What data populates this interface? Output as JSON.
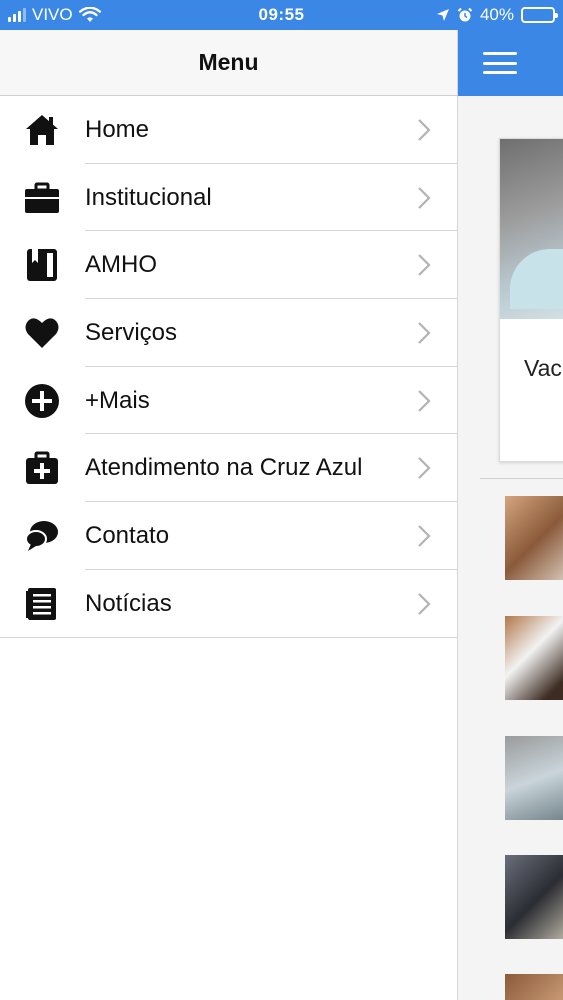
{
  "status_bar": {
    "carrier": "VIVO",
    "time": "09:55",
    "battery": "40%",
    "battery_level": 0.4
  },
  "menu": {
    "title": "Menu",
    "items": [
      {
        "label": "Home",
        "icon": "home-icon"
      },
      {
        "label": "Institucional",
        "icon": "briefcase-icon"
      },
      {
        "label": "AMHO",
        "icon": "book-icon"
      },
      {
        "label": "Serviços",
        "icon": "heart-icon"
      },
      {
        "label": "+Mais",
        "icon": "plus-circle-icon"
      },
      {
        "label": "Atendimento na Cruz Azul",
        "icon": "medkit-icon"
      },
      {
        "label": "Contato",
        "icon": "chat-bubbles-icon"
      },
      {
        "label": "Notícias",
        "icon": "newspaper-icon"
      }
    ]
  },
  "content": {
    "card_title": "Vac"
  },
  "colors": {
    "accent": "#3a87e6",
    "menu_header_bg": "#f7f7f7",
    "separator": "#d6d6d6"
  }
}
